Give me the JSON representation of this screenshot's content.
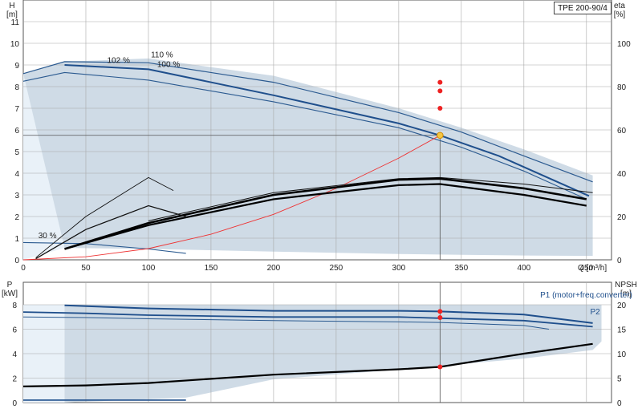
{
  "model": "TPE 200-90/4",
  "chart_data": [
    {
      "type": "line",
      "panel": "head-efficiency",
      "xlabel": "Q [m³/h]",
      "ylabel_left": "H\n[m]",
      "ylabel_right": "eta\n[%]",
      "xlim": [
        0,
        470
      ],
      "ylim_left": [
        0,
        12
      ],
      "ylim_right": [
        0,
        120
      ],
      "x_ticks": [
        0,
        50,
        100,
        150,
        200,
        250,
        300,
        350,
        400,
        450
      ],
      "y_ticks_left": [
        0,
        1,
        2,
        3,
        4,
        5,
        6,
        7,
        8,
        9,
        10,
        11
      ],
      "y_ticks_right": [
        0,
        20,
        40,
        60,
        80,
        100
      ],
      "grid": true,
      "annotations": [
        {
          "text": "110 %",
          "x": 102,
          "y": 9.35
        },
        {
          "text": "102 %",
          "x": 67,
          "y": 9.1
        },
        {
          "text": "100 %",
          "x": 107,
          "y": 8.9
        },
        {
          "text": "30 %",
          "x": 12,
          "y": 1.0
        }
      ],
      "operating_point": {
        "q": 333,
        "h": 5.75,
        "eta_points": [
          82,
          78,
          70
        ]
      },
      "series": [
        {
          "role": "envelope-upper",
          "x": [
            0,
            33,
            100,
            200,
            300,
            350,
            400,
            455
          ],
          "y": [
            8.6,
            9.15,
            9.3,
            8.5,
            7.0,
            6.1,
            5.1,
            3.9
          ]
        },
        {
          "role": "envelope-lower",
          "x": [
            33,
            100,
            200,
            300,
            350,
            400,
            455
          ],
          "y": [
            0.55,
            0.5,
            0.38,
            0.27,
            0.23,
            0.2,
            0.18
          ]
        },
        {
          "role": "head-110",
          "x": [
            0,
            33,
            100,
            200,
            300,
            350,
            400,
            455
          ],
          "y": [
            8.6,
            9.15,
            9.1,
            8.2,
            6.8,
            5.9,
            4.8,
            3.6
          ]
        },
        {
          "role": "head-102",
          "x": [
            33,
            100,
            200,
            300,
            333,
            380,
            452
          ],
          "y": [
            9.0,
            8.8,
            7.6,
            6.3,
            5.75,
            4.8,
            2.95
          ]
        },
        {
          "role": "head-100",
          "x": [
            0,
            33,
            100,
            200,
            300,
            350,
            400,
            450
          ],
          "y": [
            8.25,
            8.65,
            8.3,
            7.3,
            6.1,
            5.2,
            4.1,
            2.8
          ]
        },
        {
          "role": "head-30",
          "x": [
            0,
            50,
            100,
            130
          ],
          "y": [
            0.8,
            0.75,
            0.5,
            0.3
          ]
        },
        {
          "role": "system-curve",
          "x": [
            0,
            50,
            100,
            150,
            200,
            250,
            300,
            333
          ],
          "y": [
            0,
            0.14,
            0.52,
            1.18,
            2.1,
            3.3,
            4.7,
            5.75
          ]
        },
        {
          "role": "eta-main",
          "x": [
            33,
            100,
            200,
            300,
            333,
            400,
            450
          ],
          "y": [
            5,
            17,
            30,
            37,
            37.5,
            33,
            28
          ]
        },
        {
          "role": "eta-lower",
          "x": [
            33,
            100,
            200,
            300,
            333,
            400,
            450
          ],
          "y": [
            5,
            16,
            28,
            34.5,
            35,
            30,
            25
          ]
        },
        {
          "role": "eta-upper",
          "x": [
            100,
            200,
            300,
            333,
            400,
            455
          ],
          "y": [
            18,
            31,
            37.5,
            38,
            35,
            31
          ]
        },
        {
          "role": "eta-small-a",
          "x": [
            10,
            50,
            100,
            120
          ],
          "y": [
            1,
            20,
            38,
            32
          ]
        },
        {
          "role": "eta-small-b",
          "x": [
            10,
            50,
            100,
            130
          ],
          "y": [
            0.5,
            14,
            25,
            20
          ]
        }
      ]
    },
    {
      "type": "line",
      "panel": "power-npsh",
      "ylabel_left": "P\n[kW]",
      "ylabel_right": "NPSH\n[m]",
      "xlim": [
        0,
        470
      ],
      "ylim_left": [
        0,
        8
      ],
      "ylim_right": [
        0,
        20
      ],
      "y_ticks_left": [
        0,
        2,
        4,
        6,
        8
      ],
      "y_ticks_right": [
        0,
        5,
        10,
        15,
        20
      ],
      "grid": true,
      "labels": [
        {
          "text": "P1 (motor+freq.converter)",
          "x": 413,
          "y": 8.6
        },
        {
          "text": "P2",
          "x": 453,
          "y": 7.2
        }
      ],
      "series": [
        {
          "role": "p1",
          "x": [
            33,
            100,
            200,
            300,
            333,
            400,
            455
          ],
          "y": [
            7.95,
            7.7,
            7.5,
            7.5,
            7.45,
            7.2,
            6.5
          ]
        },
        {
          "role": "p2",
          "x": [
            0,
            50,
            100,
            200,
            300,
            333,
            400,
            455
          ],
          "y": [
            7.4,
            7.3,
            7.15,
            7.0,
            7.0,
            6.9,
            6.7,
            6.2
          ]
        },
        {
          "role": "p-lower",
          "x": [
            0,
            50,
            100,
            200,
            300,
            333,
            400,
            420
          ],
          "y": [
            7.0,
            6.95,
            6.85,
            6.7,
            6.6,
            6.55,
            6.3,
            6.0
          ]
        },
        {
          "role": "power-small",
          "x": [
            0,
            50,
            100,
            130
          ],
          "y": [
            0.2,
            0.2,
            0.2,
            0.2
          ]
        },
        {
          "role": "npsh",
          "x": [
            0,
            50,
            100,
            200,
            300,
            333,
            400,
            455
          ],
          "y": [
            3.3,
            3.5,
            4.0,
            5.7,
            6.8,
            7.3,
            10.0,
            12.0
          ]
        }
      ],
      "operating_point": {
        "q": 333,
        "p1": 7.45,
        "p2": 6.95,
        "npsh": 7.3
      }
    }
  ]
}
